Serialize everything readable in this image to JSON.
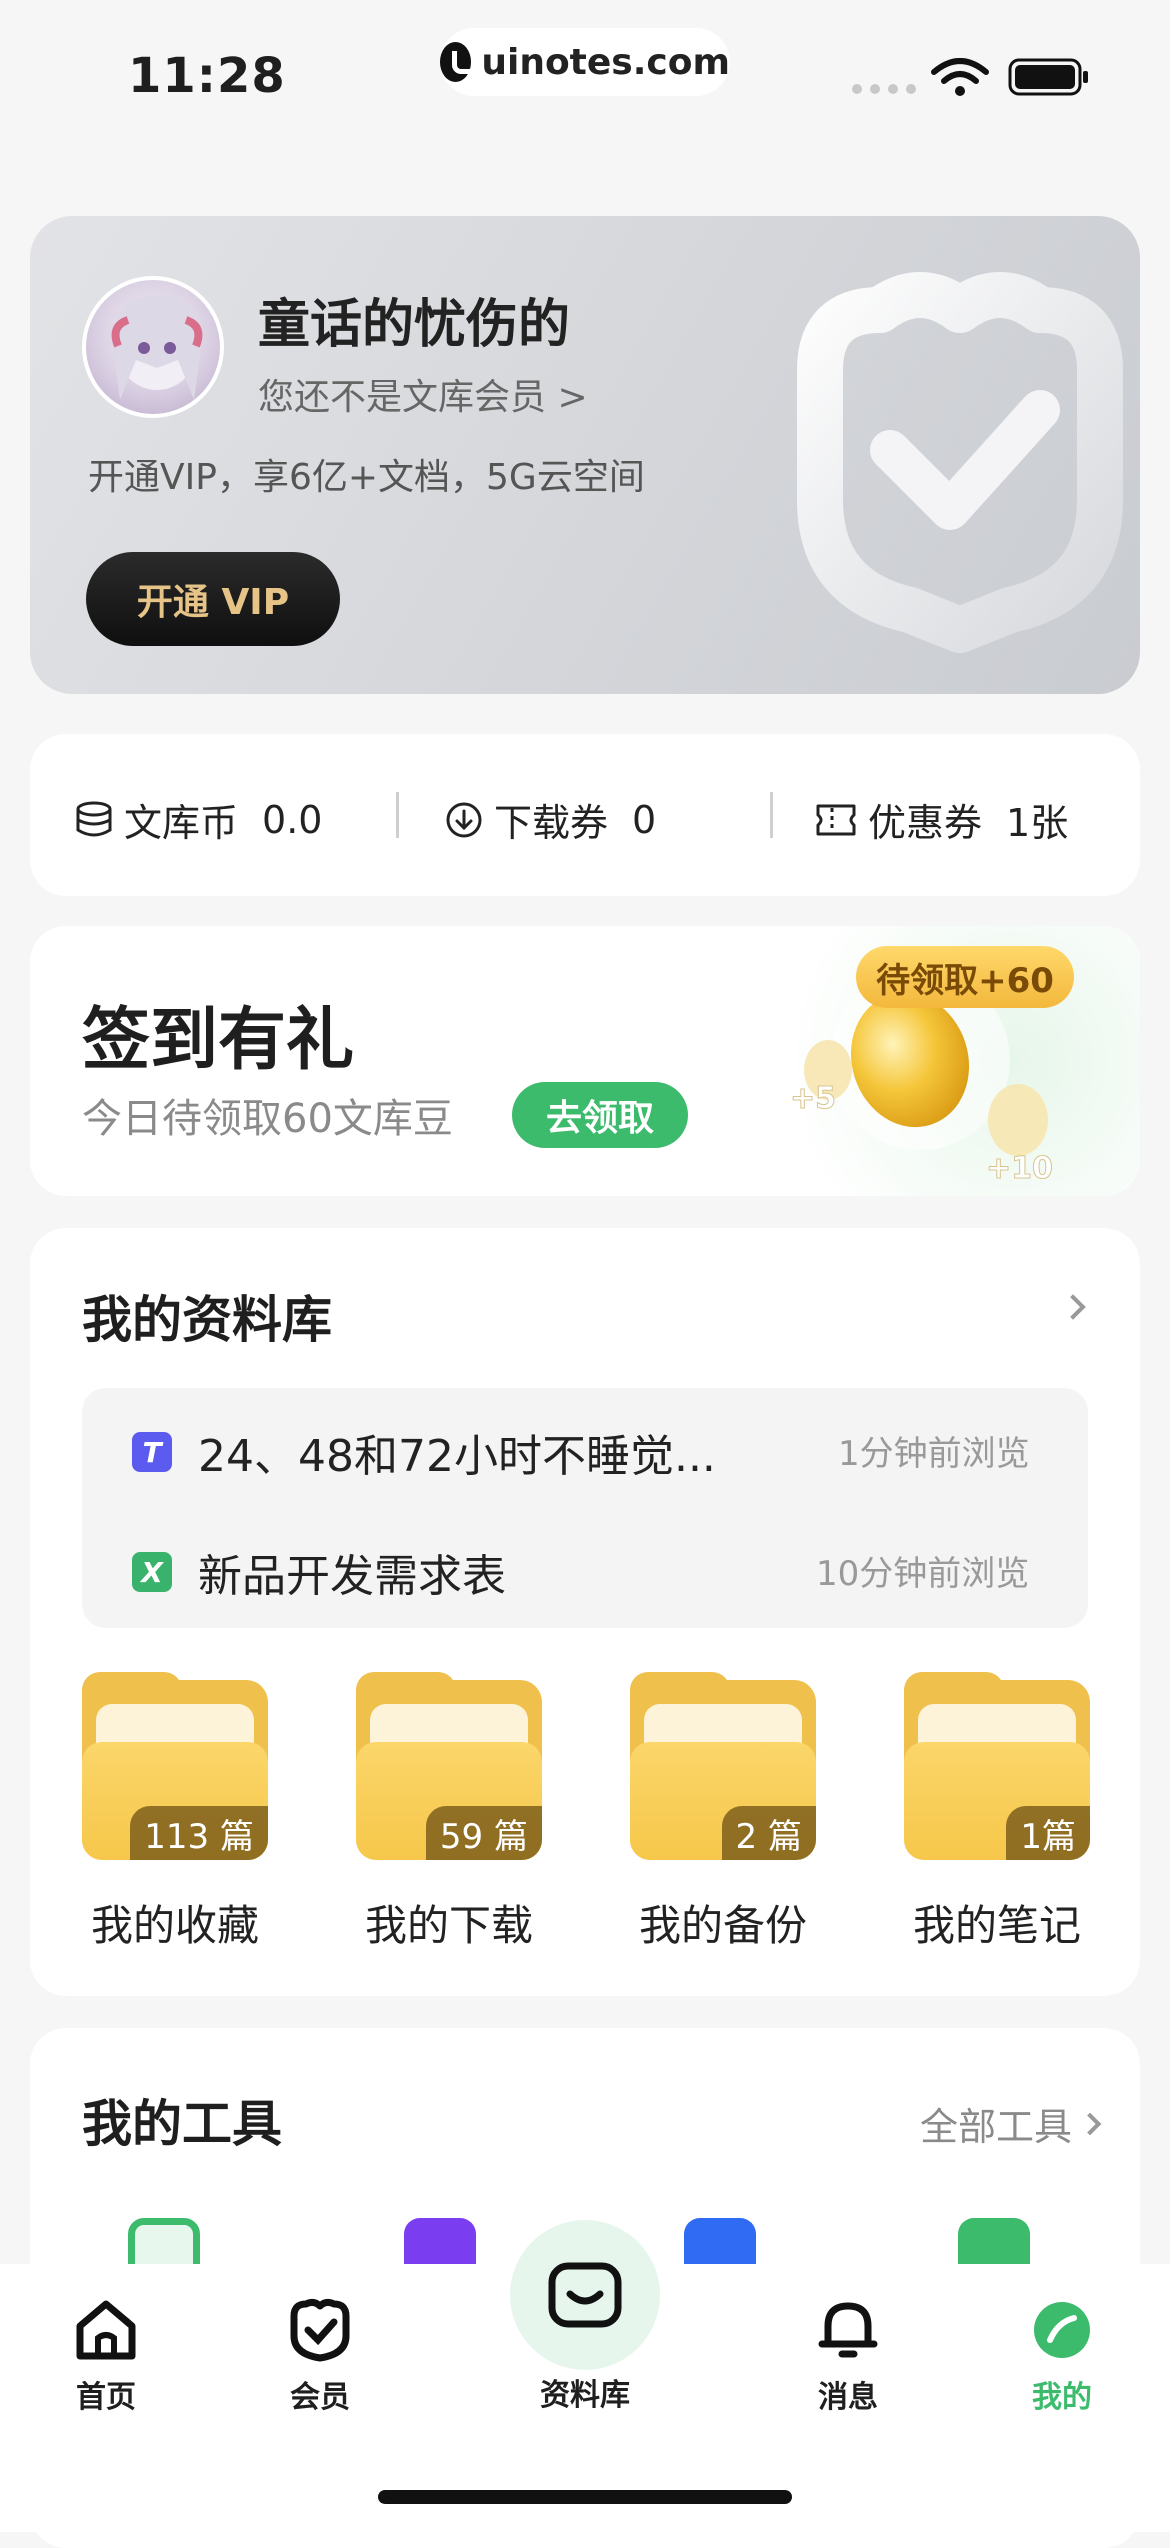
{
  "status_bar": {
    "time": "11:28",
    "url": "uinotes.com"
  },
  "profile": {
    "username": "童话的忧伤的",
    "member_link": "您还不是文库会员 >",
    "vip_desc": "开通VIP，享6亿+文档，5G云空间",
    "vip_button": "开通 VIP"
  },
  "stats": [
    {
      "label": "文库币",
      "value": "0.0",
      "icon": "coin-stack-icon"
    },
    {
      "label": "下载券",
      "value": "0",
      "icon": "download-circle-icon"
    },
    {
      "label": "优惠券",
      "value": "1张",
      "icon": "ticket-icon"
    }
  ],
  "checkin": {
    "title": "签到有礼",
    "subtitle": "今日待领取60文库豆",
    "button": "去领取",
    "bubble": "待领取+60",
    "bonus_small": "+5",
    "bonus_big": "+10"
  },
  "library": {
    "title": "我的资料库",
    "recent": [
      {
        "badge": "T",
        "title": "24、48和72小时不睡觉...",
        "time": "1分钟前浏览",
        "color": "#5b5bf0"
      },
      {
        "badge": "X",
        "title": "新品开发需求表",
        "time": "10分钟前浏览",
        "color": "#39b36b"
      }
    ],
    "folders": [
      {
        "label": "我的收藏",
        "count": "113 篇"
      },
      {
        "label": "我的下载",
        "count": "59 篇"
      },
      {
        "label": "我的备份",
        "count": "2 篇"
      },
      {
        "label": "我的笔记",
        "count": "1篇"
      }
    ]
  },
  "tools": {
    "title": "我的工具",
    "all_link": "全部工具"
  },
  "tabbar": [
    {
      "label": "首页",
      "icon": "home-icon"
    },
    {
      "label": "会员",
      "icon": "vip-badge-icon"
    },
    {
      "label": "资料库",
      "icon": "library-icon"
    },
    {
      "label": "消息",
      "icon": "bell-icon"
    },
    {
      "label": "我的",
      "icon": "profile-leaf-icon"
    }
  ],
  "colors": {
    "accent": "#3dbb6d",
    "gold": "#e6c488",
    "folder": "#f6c74a"
  }
}
